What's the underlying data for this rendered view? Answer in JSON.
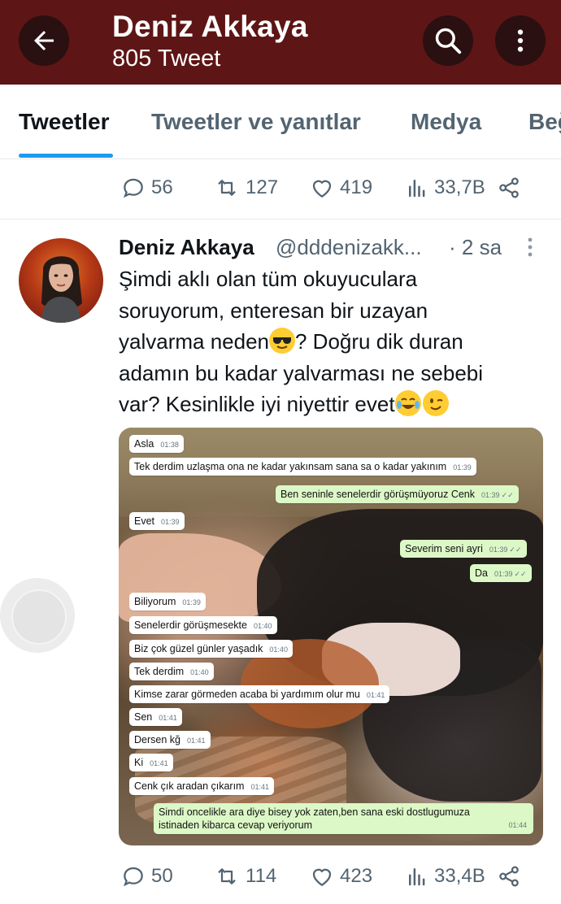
{
  "header": {
    "title": "Deniz Akkaya",
    "subtitle": "805 Tweet",
    "color": "#5e1515"
  },
  "tabs": [
    {
      "label": "Tweetler",
      "active": true
    },
    {
      "label": "Tweetler ve yanıtlar",
      "active": false
    },
    {
      "label": "Medya",
      "active": false
    },
    {
      "label": "Beğeniler",
      "active": false
    }
  ],
  "prev_tweet_actions": {
    "replies": "56",
    "retweets": "127",
    "likes": "419",
    "views": "33,7B"
  },
  "tweet": {
    "name": "Deniz Akkaya",
    "handle": "@dddenizakk...",
    "time": "· 2 sa",
    "text_line1": "Şimdi aklı olan tüm okuyuculara",
    "text_line2": "soruyorum, enteresan bir uzayan",
    "text_line3a": "yalvarma neden",
    "text_line3b": "? Doğru dik duran",
    "text_line4": "adamın bu kadar yalvarması ne sebebi",
    "text_line5": "var? Kesinlikle iyi niyettir evet",
    "emoji_1": "sunglasses-face",
    "emoji_2": "tears-of-joy-face",
    "emoji_3": "winking-face",
    "actions": {
      "replies": "50",
      "retweets": "114",
      "likes": "423",
      "views": "33,4B"
    }
  },
  "chat": {
    "messages": [
      {
        "text": "Asla",
        "time": "01:38",
        "dir": "in"
      },
      {
        "text": "Tek derdim uzlaşma ona ne kadar yakınsam sana sa o kadar yakınım",
        "time": "01:39",
        "dir": "in"
      },
      {
        "text": "Ben seninle senelerdir görüşmüyoruz Cenk",
        "time": "01:39",
        "dir": "out"
      },
      {
        "text": "Evet",
        "time": "01:39",
        "dir": "in"
      },
      {
        "text": "Severim seni ayri",
        "time": "01:39",
        "dir": "out"
      },
      {
        "text": "Da",
        "time": "01:39",
        "dir": "out"
      },
      {
        "text": "Biliyorum",
        "time": "01:39",
        "dir": "in"
      },
      {
        "text": "Senelerdir görüşmesekte",
        "time": "01:40",
        "dir": "in"
      },
      {
        "text": "Biz çok güzel günler yaşadık",
        "time": "01:40",
        "dir": "in"
      },
      {
        "text": "Tek derdim",
        "time": "01:40",
        "dir": "in"
      },
      {
        "text": "Kimse zarar görmeden acaba bi yardımım olur mu",
        "time": "01:41",
        "dir": "in"
      },
      {
        "text": "Sen",
        "time": "01:41",
        "dir": "in"
      },
      {
        "text": "Dersen kğ",
        "time": "01:41",
        "dir": "in"
      },
      {
        "text": "Ki",
        "time": "01:41",
        "dir": "in"
      },
      {
        "text": "Cenk çık aradan çıkarım",
        "time": "01:41",
        "dir": "in"
      },
      {
        "text": "Simdi oncelikle ara diye bisey yok zaten,ben sana eski dostlugumuza istinaden kibarca cevap veriyorum",
        "time": "01:44",
        "dir": "out"
      }
    ]
  }
}
